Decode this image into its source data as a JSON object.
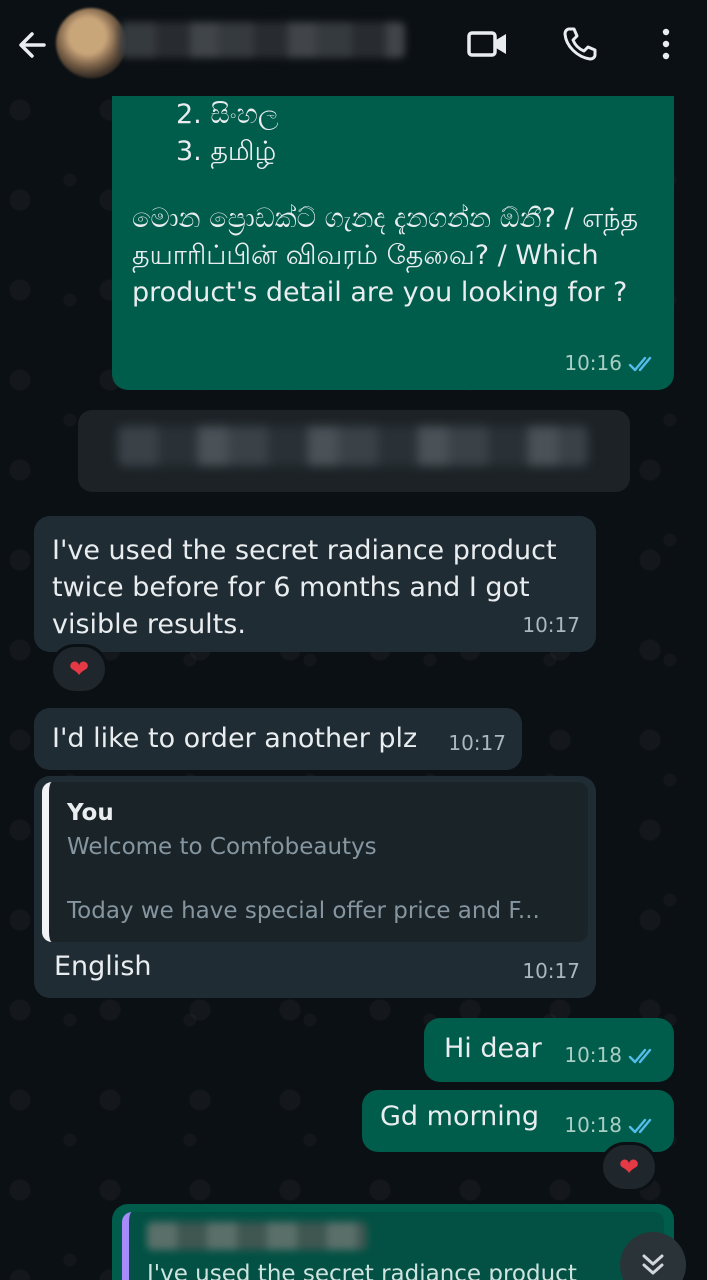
{
  "header": {
    "contact_name": "",
    "icons": [
      "back-arrow-icon",
      "avatar",
      "video-call-icon",
      "voice-call-icon",
      "more-options-icon"
    ]
  },
  "messages": {
    "m1": {
      "list_item_2": "2. සිංහල",
      "list_item_3": "3. தமிழ்",
      "prompt": "මොන ප්‍රොඩක්ට් ගැනද දැනගන්න ඕනී?  / எந்த தயாரிப்பின் விவரம் தேவை? / Which product's detail are you looking for ?",
      "time": "10:16"
    },
    "m2": {
      "text": "I've used the secret radiance product twice before for 6 months and I got visible results.",
      "time": "10:17",
      "reaction": "❤"
    },
    "m3": {
      "text": "I'd like to order another plz",
      "time": "10:17"
    },
    "m4": {
      "quote_author": "You",
      "quote_line1": "Welcome to Comfobeautys",
      "quote_line2": "Today we have special offer price and F...",
      "text": "English",
      "time": "10:17"
    },
    "m5": {
      "text": "Hi dear",
      "time": "10:18"
    },
    "m6": {
      "text": "Gd morning",
      "time": "10:18",
      "reaction": "❤"
    },
    "m7": {
      "quote_preview": "I've used the secret radiance product"
    }
  },
  "colors": {
    "outgoing_bubble": "#005c4b",
    "incoming_bubble": "#202c33",
    "read_ticks": "#53bdeb",
    "background": "#0b1014"
  }
}
